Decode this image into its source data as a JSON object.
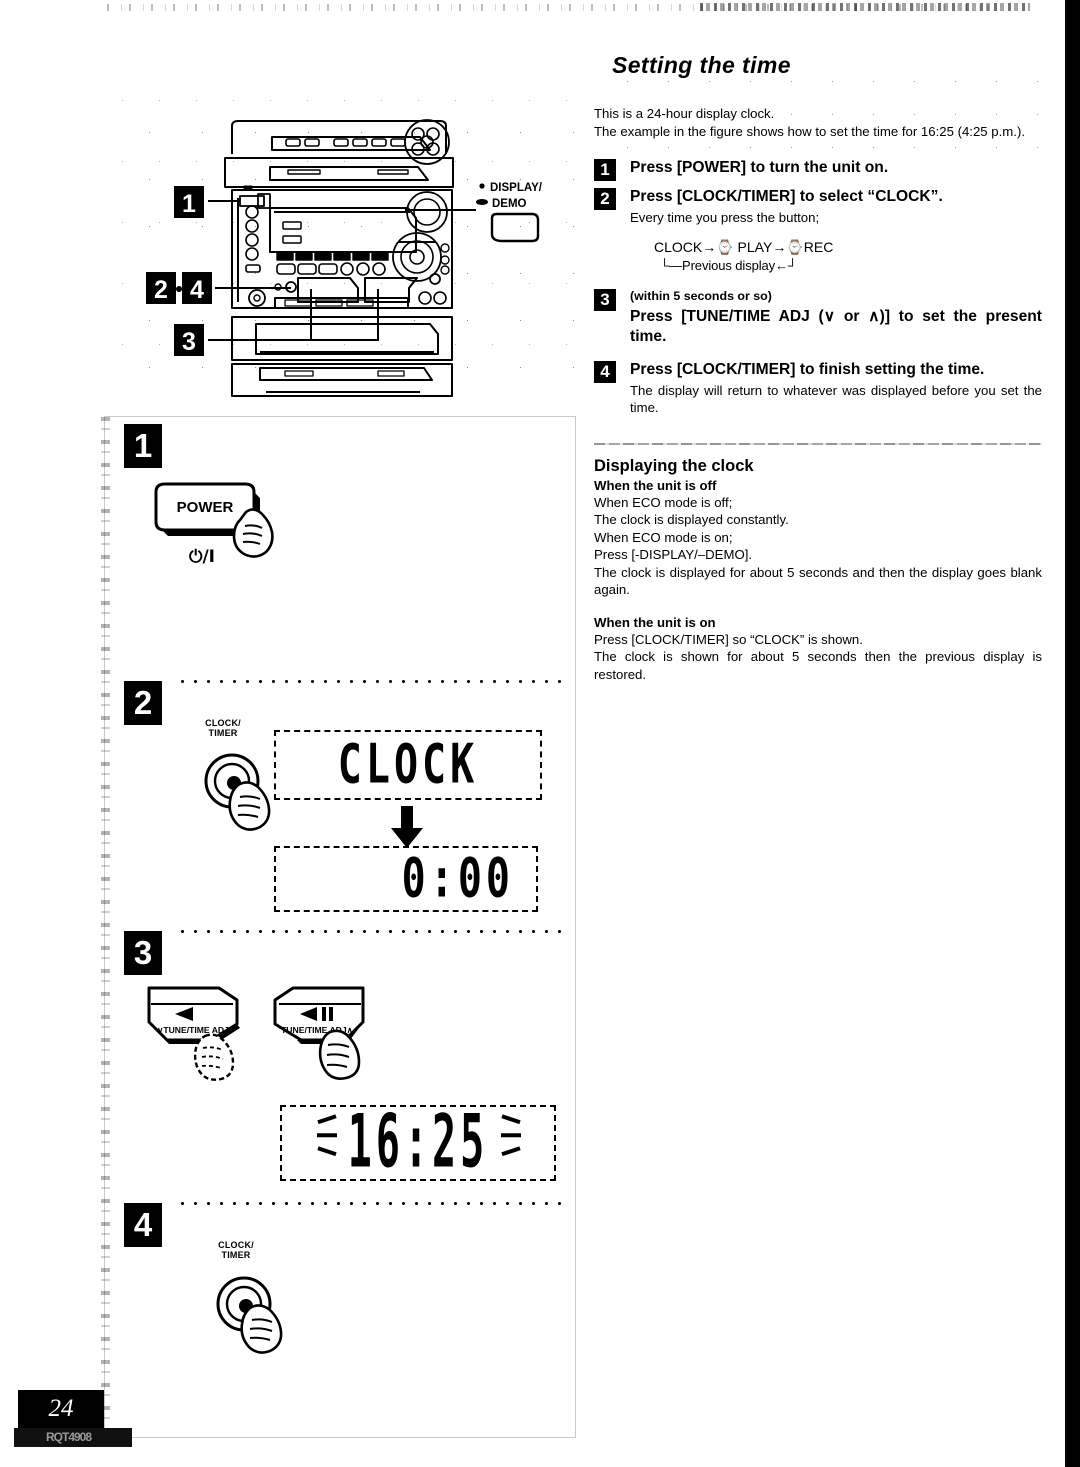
{
  "document": {
    "title": "Setting the time",
    "page_number": "24",
    "footer_code": "RQT4908"
  },
  "intro": {
    "line1": "This is a 24-hour display clock.",
    "line2": "The example in the figure shows how to set the time for 16:25 (4:25 p.m.)."
  },
  "steps": [
    {
      "num": "1",
      "heading": "Press [POWER] to turn the unit on."
    },
    {
      "num": "2",
      "heading": "Press [CLOCK/TIMER] to select “CLOCK”.",
      "sub": "Every time you press the button;",
      "flow": "CLOCK→⌚ PLAY→⌚REC",
      "flow_return": "└—Previous display←┘"
    },
    {
      "num": "3",
      "note": "(within 5 seconds or so)",
      "heading": "Press [TUNE/TIME ADJ (∨ or ∧)] to set the present time."
    },
    {
      "num": "4",
      "heading": "Press [CLOCK/TIMER] to finish setting the time.",
      "sub": "The display will return to whatever was displayed before you set the time."
    }
  ],
  "section": {
    "title": "Displaying the clock",
    "unit_off": {
      "heading": "When the unit is off",
      "lines": [
        "When ECO mode is off;",
        "The clock is displayed constantly.",
        "When ECO mode is on;",
        "Press [-DISPLAY/–DEMO]."
      ],
      "paragraph": "The clock is displayed for about 5 seconds and then the display goes blank again."
    },
    "unit_on": {
      "heading": "When the unit is on",
      "line1": "Press [CLOCK/TIMER] so “CLOCK” is shown.",
      "paragraph": "The clock is shown for about 5 seconds then the previous display is restored."
    }
  },
  "figure_top": {
    "callout_1": "1",
    "callout_24": "2·4",
    "callout_3": "3",
    "display_demo_line1": "DISPLAY/",
    "display_demo_line2": "DEMO"
  },
  "figure_steps": {
    "step1": {
      "num": "1",
      "button_label": "POWER",
      "power_symbol": "⏻/I"
    },
    "step2": {
      "num": "2",
      "button_label_line1": "CLOCK/",
      "button_label_line2": "TIMER",
      "display_before": "CLOCK",
      "display_after": "0:00"
    },
    "step3": {
      "num": "3",
      "left_button_arrow": "◀",
      "left_button_label": "∨TUNE/TIME ADJ",
      "right_button_arrow": "▶/II",
      "right_button_label": "TUNE/TIME ADJ∧",
      "display_value": "16:25"
    },
    "step4": {
      "num": "4",
      "button_label_line1": "CLOCK/",
      "button_label_line2": "TIMER"
    }
  }
}
